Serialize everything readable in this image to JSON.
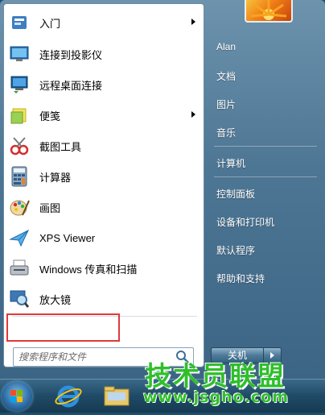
{
  "start_menu": {
    "programs": [
      {
        "label": "入门",
        "icon": "getting-started-icon",
        "has_submenu": true
      },
      {
        "label": "连接到投影仪",
        "icon": "projector-icon",
        "has_submenu": false
      },
      {
        "label": "远程桌面连接",
        "icon": "remote-desktop-icon",
        "has_submenu": false
      },
      {
        "label": "便笺",
        "icon": "sticky-notes-icon",
        "has_submenu": true
      },
      {
        "label": "截图工具",
        "icon": "snipping-tool-icon",
        "has_submenu": false
      },
      {
        "label": "计算器",
        "icon": "calculator-icon",
        "has_submenu": false
      },
      {
        "label": "画图",
        "icon": "paint-icon",
        "has_submenu": false
      },
      {
        "label": "XPS Viewer",
        "icon": "xps-viewer-icon",
        "has_submenu": false
      },
      {
        "label": "Windows 传真和扫描",
        "icon": "fax-scan-icon",
        "has_submenu": false
      },
      {
        "label": "放大镜",
        "icon": "magnifier-icon",
        "has_submenu": false
      }
    ],
    "search": {
      "placeholder": "搜索程序和文件"
    },
    "right_links": [
      {
        "label": "Alan"
      },
      {
        "label": "文档"
      },
      {
        "label": "图片"
      },
      {
        "label": "音乐"
      },
      {
        "label": "计算机"
      },
      {
        "label": "控制面板"
      },
      {
        "label": "设备和打印机"
      },
      {
        "label": "默认程序"
      },
      {
        "label": "帮助和支持"
      }
    ],
    "shutdown_label": "关机"
  },
  "watermark": {
    "title": "技术员联盟",
    "url": "www.jsgho.com"
  },
  "colors": {
    "highlight_border": "#e0393a",
    "watermark_green": "#2fbf2b",
    "menu_blue": "#4d7694"
  }
}
